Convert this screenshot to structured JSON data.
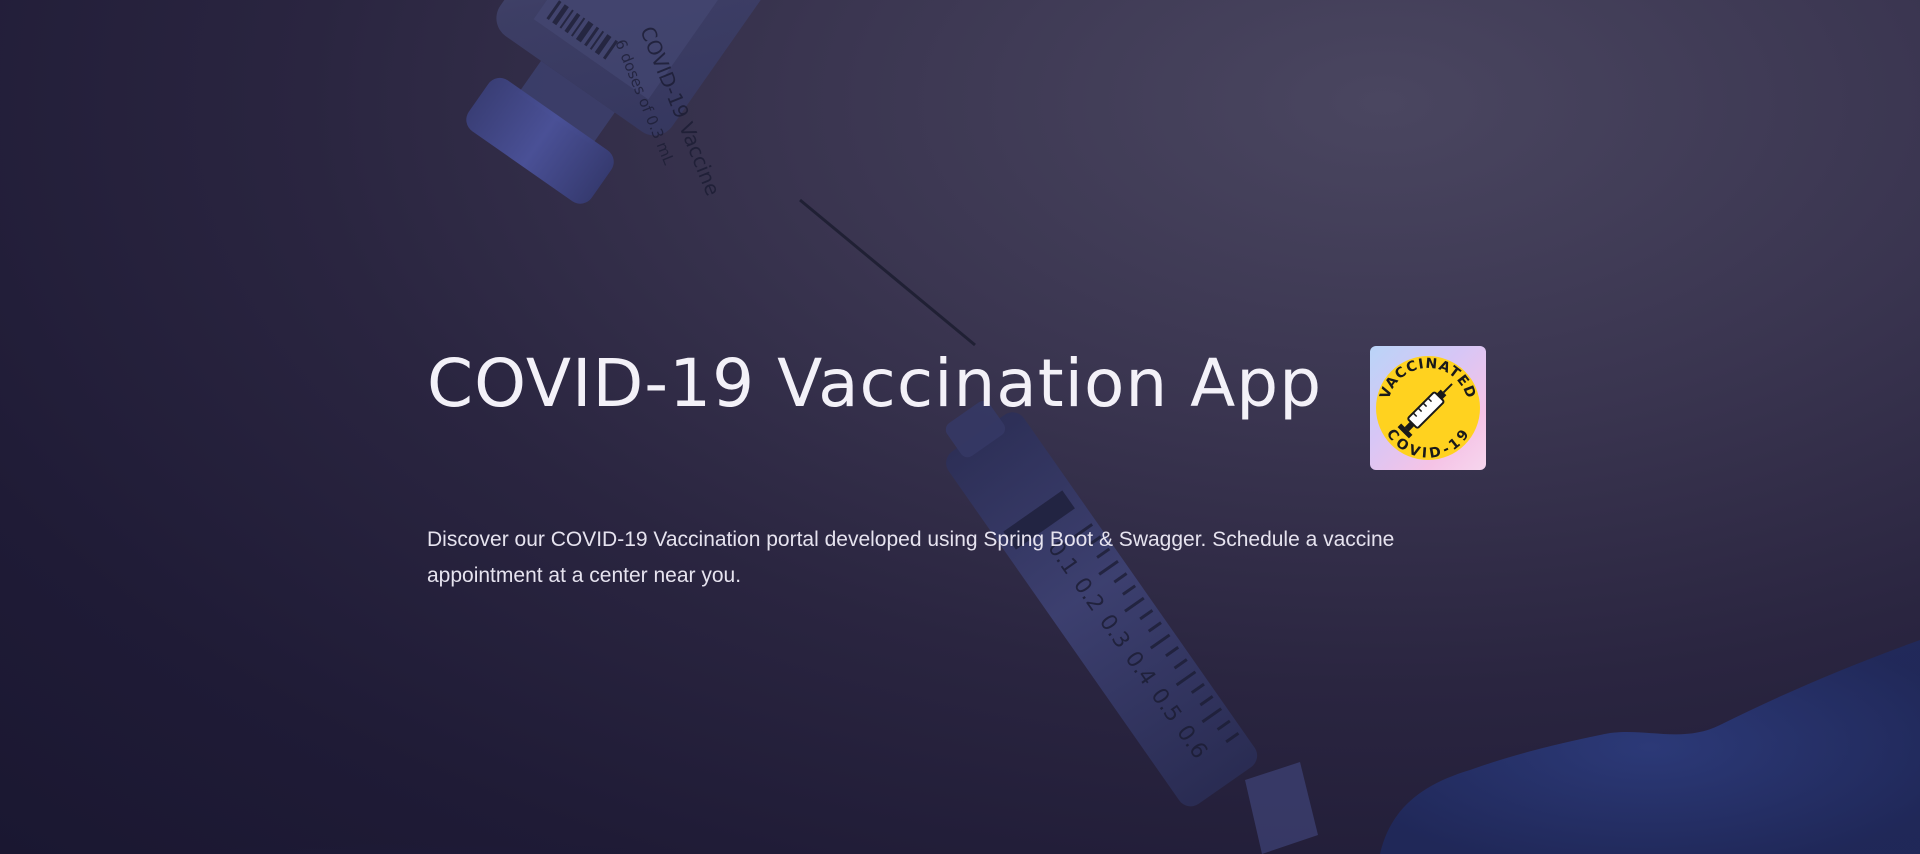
{
  "hero": {
    "title": "COVID-19 Vaccination App",
    "description": "Discover our COVID-19 Vaccination portal developed using Spring Boot & Swagger. Schedule a vaccine appointment at a center near you.",
    "background_image": "vaccine-vial-and-syringe-photo",
    "vial_label": {
      "line1": "COVID-19 Vaccine",
      "line2": "6 doses of 0.3 mL"
    },
    "syringe_marks": [
      "0.1",
      "0.2",
      "0.3",
      "0.4",
      "0.5",
      "0.6"
    ]
  },
  "badge": {
    "top_text": "VACCINATED",
    "bottom_text": "COVID-19",
    "icon": "syringe-icon",
    "colors": {
      "circle": "#ffd21f",
      "text": "#1a1a1a"
    }
  },
  "colors": {
    "overlay": "#1f1b36",
    "title": "#f3f1f8",
    "text": "#e6e3ef"
  }
}
